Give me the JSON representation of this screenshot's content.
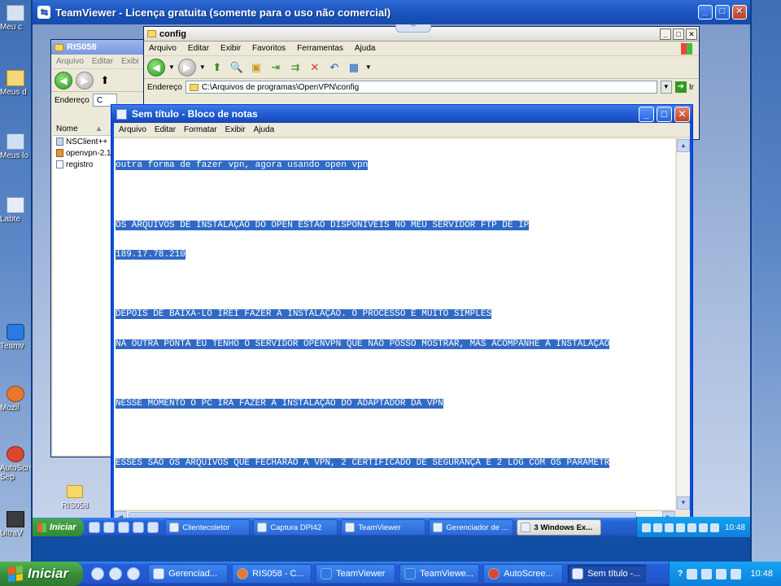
{
  "local_desktop": {
    "icons": [
      {
        "label": "Meu c"
      },
      {
        "label": "Meus d"
      },
      {
        "label": "Meus lo"
      },
      {
        "label": "Labte"
      },
      {
        "label": "Teamv"
      },
      {
        "label": "Mozil"
      },
      {
        "label": "AutoScre Sep"
      },
      {
        "label": "UltraV"
      }
    ]
  },
  "teamviewer": {
    "title": "TeamViewer - Licença gratuita (somente para o uso não comercial)",
    "controls": {
      "minimize": "_",
      "maximize": "□",
      "close": "✕"
    }
  },
  "remote": {
    "desktop_icons": [
      {
        "label": "RIS058"
      }
    ],
    "explorer_ris": {
      "title": "RIS058",
      "menu": [
        "Arquivo",
        "Editar",
        "Exibi"
      ],
      "address_label": "Endereço",
      "address_value": "C",
      "column_header": "Nome",
      "files": [
        "NSClient++",
        "openvpn-2.1",
        "registro"
      ]
    },
    "explorer_config": {
      "title": "config",
      "menu": [
        "Arquivo",
        "Editar",
        "Exibir",
        "Favoritos",
        "Ferramentas",
        "Ajuda"
      ],
      "address_label": "Endereço",
      "address_value": "C:\\Arquivos de programas\\OpenVPN\\config",
      "go_label": "Ir"
    },
    "notepad": {
      "title": "Sem título - Bloco de notas",
      "menu": [
        "Arquivo",
        "Editar",
        "Formatar",
        "Exibir",
        "Ajuda"
      ],
      "lines": [
        "outra forma de fazer vpn, agora usando open vpn",
        "",
        "OS ARQUIVOS DE INSTALAÇÃO DO OPEN ESTÃO DISPONIVEIS NO MEU SERVIDOR FTP DE IP",
        "189.17.78.210",
        "",
        "DEPOIS DE BAIXA-LO IREI FAZER A INSTALAÇAO. O PROCESSO É MUITO SIMPLES",
        "NA OUTRA PONTA EU TENHO O SERVIDOR OPENVPN QUE NÃO POSSO MOSTRAR, MAS ACOMPANHE A INSTALAÇÃO",
        "",
        "NESSE MOMENTO O PC IRA FAZER A INSTALAÇÃO DO ADAPTADOR DA VPN",
        "",
        "ESSES SÃO OS ARQUIVOS QUE FECHARÃO A VPN, 2 CERTIFICADO DE SEGURANÇA E 2 LOG COM OS PARAMETR"
      ]
    },
    "taskbar": {
      "start_label": "Iniciar",
      "tasks": [
        {
          "label": "Clientecoletor",
          "active": false
        },
        {
          "label": "Captura DPI42",
          "active": false
        },
        {
          "label": "TeamViewer",
          "active": false
        },
        {
          "label": "Gerenciador de ...",
          "active": false
        },
        {
          "label": "3 Windows Ex...",
          "active": true
        }
      ],
      "clock": "10:48"
    }
  },
  "taskbar": {
    "start_label": "Iniciar",
    "tasks": [
      {
        "label": "Gerenciad...",
        "active": false
      },
      {
        "label": "RIS058 - C...",
        "active": false
      },
      {
        "label": "TeamViewer",
        "active": false
      },
      {
        "label": "TeamViewe...",
        "active": false
      },
      {
        "label": "AutoScree...",
        "active": false
      },
      {
        "label": "Sem título -...",
        "active": true
      }
    ],
    "clock": "10:48"
  }
}
